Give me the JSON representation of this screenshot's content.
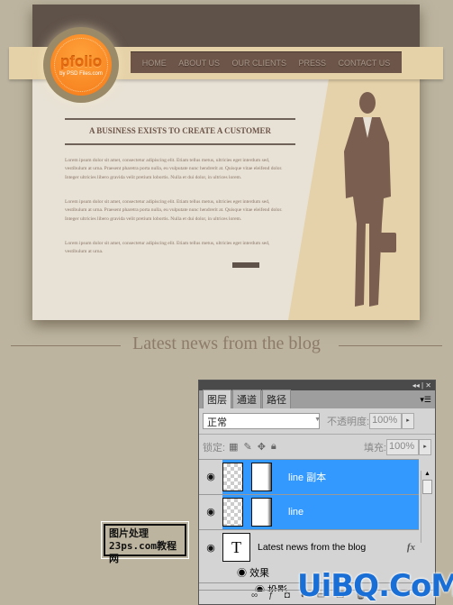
{
  "site": {
    "logo": {
      "name": "pfolio",
      "tagline": "by PSD Files.com"
    },
    "nav": [
      "HOME",
      "ABOUT US",
      "OUR CLIENTS",
      "PRESS",
      "CONTACT US"
    ],
    "heading": "A BUSINESS EXISTS TO CREATE A CUSTOMER",
    "paragraphs": [
      "Lorem ipsum dolor sit amet, consectetur adipiscing elit. Etiam tellus metus, ultricies eget interdum sed, vestibulum at urna. Praesent pharetra porta nulla, eu vulputate nunc hendrerit at. Quisque vitae eleifend dolor. Integer ultricies libero gravida velit pretium lobortis. Nulla et dui dolor, in ultrices lorem.",
      "Lorem ipsum dolor sit amet, consectetur adipiscing elit. Etiam tellus metus, ultricies eget interdum sed, vestibulum at urna. Praesent pharetra porta nulla, eu vulputate nunc hendrerit at. Quisque vitae eleifend dolor. Integer ultricies libero gravida velit pretium lobortis. Nulla et dui dolor, in ultrices lorem.",
      "Lorem ipsum dolor sit amet, consectetur adipiscing elit. Etiam tellus metus, ultricies eget interdum sed, vestibulum at urna."
    ],
    "latest": "Latest news from the blog"
  },
  "watermark_23ps": {
    "line1": "图片处理",
    "line2": "23ps.com",
    "line3": "教程网"
  },
  "watermark_uibq": "UiBQ.CoM",
  "layers_panel": {
    "tabs": [
      "图层",
      "通道",
      "路径"
    ],
    "blend_mode": "正常",
    "opacity_label": "不透明度:",
    "opacity": "100%",
    "lock_label": "锁定:",
    "fill_label": "填充:",
    "fill": "100%",
    "layers": [
      {
        "name": "line 副本",
        "selected": true
      },
      {
        "name": "line",
        "selected": true
      },
      {
        "name": "Latest news from the blog",
        "selected": false,
        "fx": "fx"
      }
    ],
    "effects_label": "效果",
    "effect_item": "投影"
  },
  "colors": {
    "accent_orange": "#f57a18",
    "header_brown": "#5f5249",
    "selection_blue": "#3399ff"
  }
}
